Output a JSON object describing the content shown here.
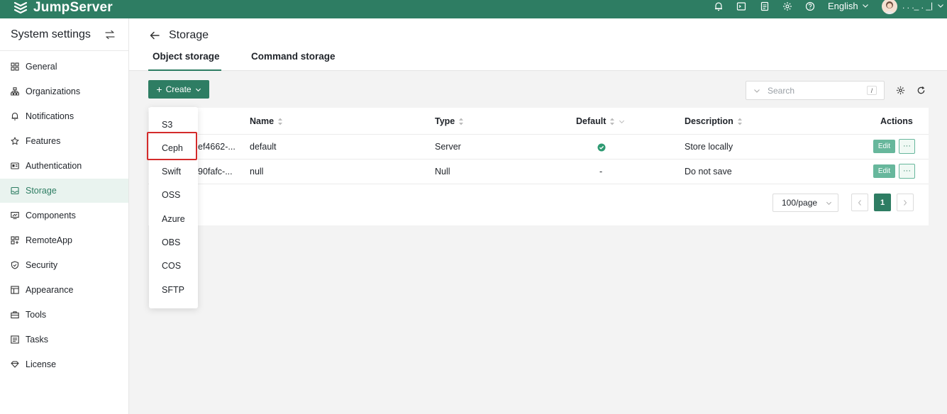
{
  "topbar": {
    "brand": "JumpServer",
    "language": "English",
    "user_name": ". . ._ .  _|"
  },
  "icons": [
    "bell-icon",
    "terminal-icon",
    "document-icon",
    "gear-icon",
    "help-icon",
    "chevron-down-icon",
    "avatar"
  ],
  "sidebar": {
    "title": "System settings",
    "items": [
      {
        "label": "General",
        "icon": "grid-icon"
      },
      {
        "label": "Organizations",
        "icon": "org-chart-icon"
      },
      {
        "label": "Notifications",
        "icon": "bell-icon"
      },
      {
        "label": "Features",
        "icon": "star-icon"
      },
      {
        "label": "Authentication",
        "icon": "id-card-icon"
      },
      {
        "label": "Storage",
        "icon": "inbox-icon",
        "active": true
      },
      {
        "label": "Components",
        "icon": "monitor-icon"
      },
      {
        "label": "RemoteApp",
        "icon": "apps-icon"
      },
      {
        "label": "Security",
        "icon": "shield-icon"
      },
      {
        "label": "Appearance",
        "icon": "layout-icon"
      },
      {
        "label": "Tools",
        "icon": "toolbox-icon"
      },
      {
        "label": "Tasks",
        "icon": "list-icon"
      },
      {
        "label": "License",
        "icon": "diamond-icon"
      }
    ]
  },
  "page": {
    "title": "Storage",
    "tabs": [
      {
        "label": "Object storage",
        "active": true
      },
      {
        "label": "Command storage",
        "active": false
      }
    ]
  },
  "toolbar": {
    "create_label": "Create",
    "search_placeholder": "Search",
    "search_shortcut": "/"
  },
  "table": {
    "columns": [
      "Name",
      "Type",
      "Default",
      "Description",
      "Actions"
    ],
    "rows": [
      {
        "id": "ef4662-...",
        "name": "default",
        "type": "Server",
        "default": "check",
        "description": "Store locally",
        "edit": "Edit",
        "more": "···"
      },
      {
        "id": "90fafc-...",
        "name": "null",
        "type": "Null",
        "default": "-",
        "description": "Do not save",
        "edit": "Edit",
        "more": "···"
      }
    ]
  },
  "pagination": {
    "page_size": "100/page",
    "current_page": "1"
  },
  "create_menu": {
    "items": [
      "S3",
      "Ceph",
      "Swift",
      "OSS",
      "Azure",
      "OBS",
      "COS",
      "SFTP"
    ],
    "highlighted": "Ceph"
  },
  "colors": {
    "brand": "#2e7d63",
    "active_bg": "#e9f3ef",
    "highlight_border": "#d42b2b"
  }
}
